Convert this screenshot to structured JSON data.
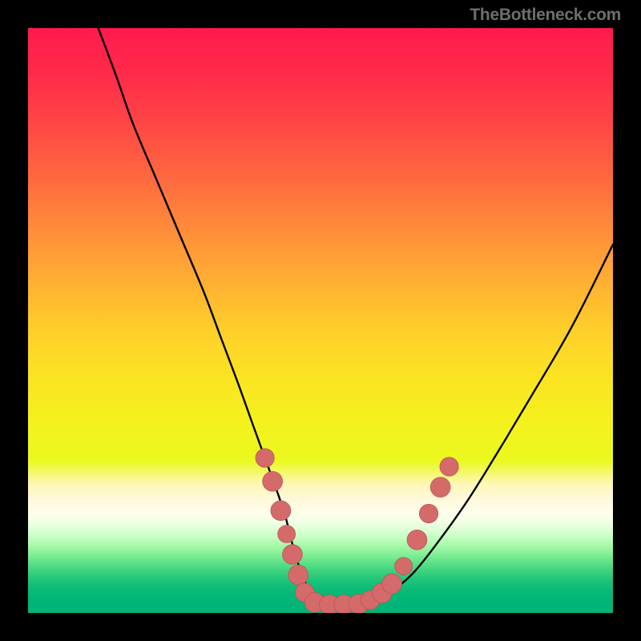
{
  "watermark": "TheBottleneck.com",
  "colors": {
    "frame": "#000000",
    "curve": "#000000",
    "markerFill": "#d46a6a",
    "markerStroke": "#ba5858",
    "gradientTop": "#ff1a4d",
    "gradientMid": "#ffd02a",
    "gradientBand": "#fef7b8",
    "gradientBottom": "#00b478"
  },
  "chart_data": {
    "type": "line",
    "title": "",
    "xlabel": "",
    "ylabel": "",
    "xlim": [
      0,
      100
    ],
    "ylim": [
      0,
      100
    ],
    "series": [
      {
        "name": "bottleneck-curve",
        "x": [
          12,
          15,
          18,
          22,
          26,
          30,
          33,
          36,
          38.5,
          40.5,
          42.5,
          44,
          45,
          46,
          47,
          48.5,
          50.5,
          53,
          56,
          59,
          62.5,
          66,
          70,
          75,
          80,
          86,
          93,
          100
        ],
        "y": [
          100,
          92,
          83.5,
          74,
          64.5,
          55,
          47,
          39,
          32,
          26.5,
          21,
          16.5,
          12.5,
          9,
          6,
          3.5,
          2,
          1.4,
          1.4,
          2.2,
          4,
          7,
          12,
          19,
          27,
          37,
          49,
          63
        ]
      }
    ],
    "markers": [
      {
        "x": 40.5,
        "y": 26.5,
        "r": 1.6
      },
      {
        "x": 41.8,
        "y": 22.5,
        "r": 1.7
      },
      {
        "x": 43.2,
        "y": 17.5,
        "r": 1.7
      },
      {
        "x": 44.2,
        "y": 13.5,
        "r": 1.5
      },
      {
        "x": 45.2,
        "y": 10.0,
        "r": 1.7
      },
      {
        "x": 46.2,
        "y": 6.5,
        "r": 1.7
      },
      {
        "x": 47.3,
        "y": 3.5,
        "r": 1.6
      },
      {
        "x": 49.0,
        "y": 1.8,
        "r": 1.7
      },
      {
        "x": 51.5,
        "y": 1.4,
        "r": 1.7
      },
      {
        "x": 54.0,
        "y": 1.4,
        "r": 1.7
      },
      {
        "x": 56.5,
        "y": 1.5,
        "r": 1.7
      },
      {
        "x": 58.5,
        "y": 2.2,
        "r": 1.6
      },
      {
        "x": 60.5,
        "y": 3.4,
        "r": 1.7
      },
      {
        "x": 62.2,
        "y": 5.0,
        "r": 1.7
      },
      {
        "x": 64.2,
        "y": 8.0,
        "r": 1.5
      },
      {
        "x": 66.5,
        "y": 12.5,
        "r": 1.7
      },
      {
        "x": 68.5,
        "y": 17.0,
        "r": 1.6
      },
      {
        "x": 70.5,
        "y": 21.5,
        "r": 1.7
      },
      {
        "x": 72.0,
        "y": 25.0,
        "r": 1.6
      }
    ]
  }
}
